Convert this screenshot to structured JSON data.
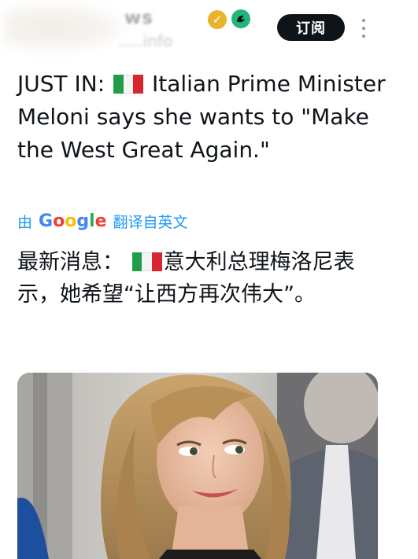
{
  "header": {
    "account_name": "ws",
    "account_handle": ".....info",
    "subscribe_label": "订阅",
    "icons": {
      "verified": "verified-badge-icon",
      "affiliate": "affiliate-badge-icon",
      "more": "more-options-icon"
    },
    "colors": {
      "verified": "#e7b42b",
      "affiliate": "#1fb57b",
      "button": "#0f1419"
    }
  },
  "tweet": {
    "line1_prefix": "JUST IN: ",
    "flag_icon": "italy-flag-icon",
    "line1_suffix": " Italian Prime Minister Meloni says she wants to \"Make the West Great Again.\""
  },
  "translation": {
    "prefix": "由",
    "provider": "Google",
    "suffix": "翻译自英文",
    "text_prefix": "最新消息： ",
    "text_suffix": "意大利总理梅洛尼表示，她希望“让西方再次伟大”。",
    "link_color": "#1d9bf0"
  },
  "media": {
    "type": "photo",
    "icon": "photo-of-woman-smiling"
  }
}
